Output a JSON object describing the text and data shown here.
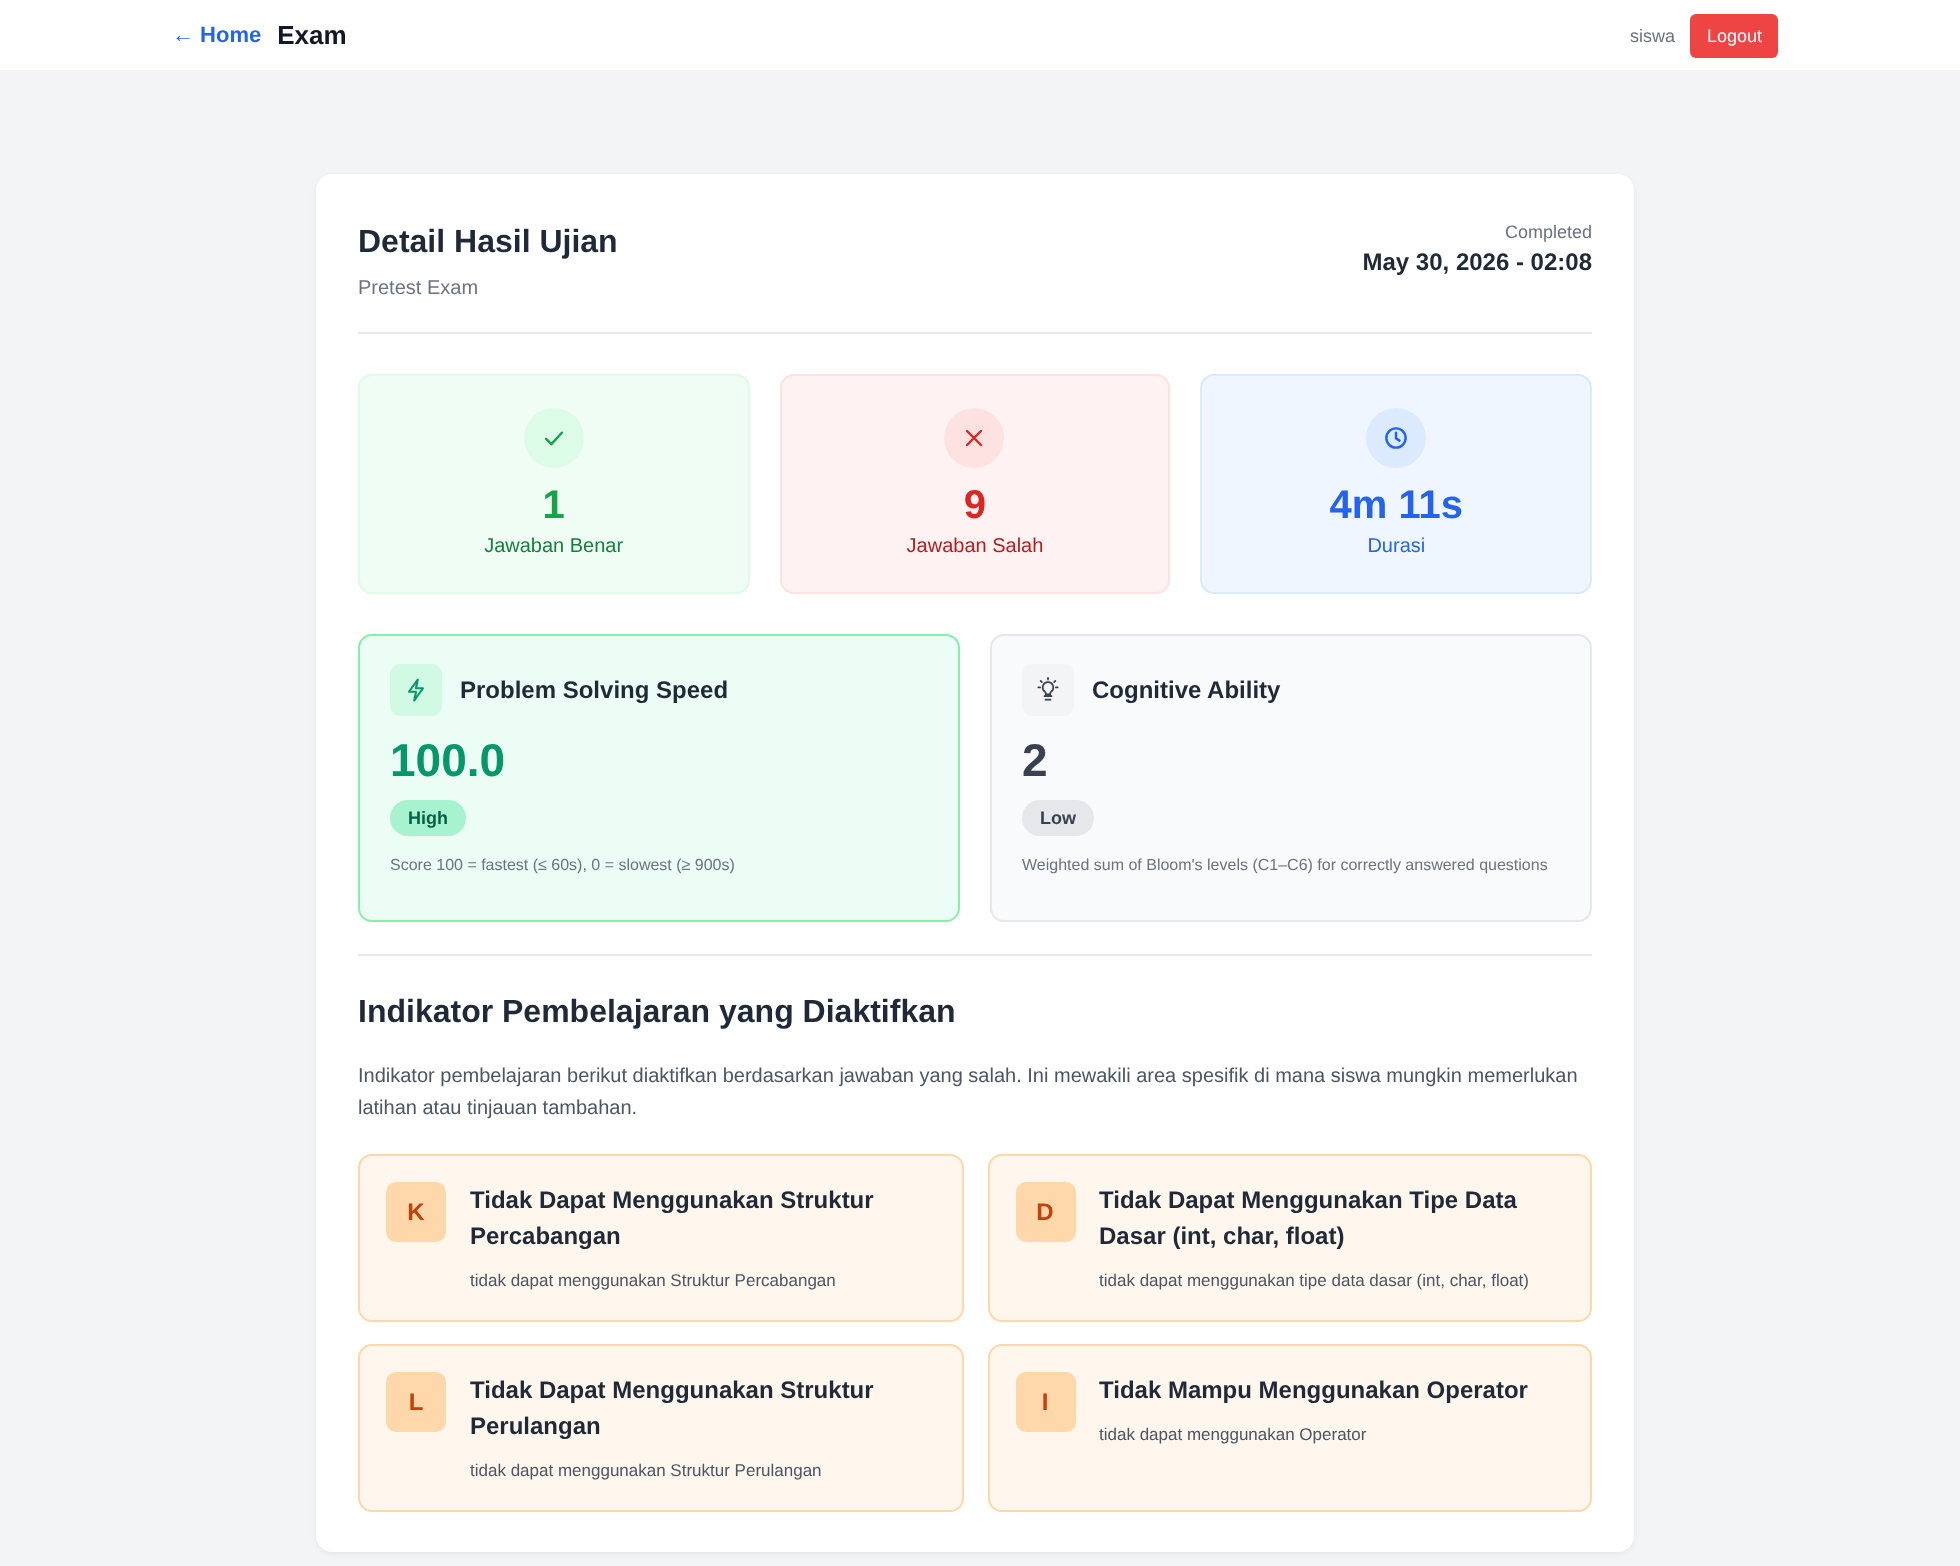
{
  "header": {
    "back_link": "← Home",
    "title": "Exam",
    "user": "siswa",
    "logout": "Logout"
  },
  "result": {
    "title": "Detail Hasil Ujian",
    "subtitle": "Pretest Exam",
    "status": "Completed",
    "date": "May 30, 2026 - 02:08"
  },
  "stats": [
    {
      "kind": "correct",
      "value": "1",
      "label": "Jawaban Benar"
    },
    {
      "kind": "wrong",
      "value": "9",
      "label": "Jawaban Salah"
    },
    {
      "kind": "duration",
      "value": "4m 11s",
      "label": "Durasi"
    }
  ],
  "metrics": [
    {
      "kind": "speed",
      "title": "Problem Solving Speed",
      "value": "100.0",
      "badge": "High",
      "note": "Score 100 = fastest (≤ 60s), 0 = slowest (≥ 900s)"
    },
    {
      "kind": "cognitive",
      "title": "Cognitive Ability",
      "value": "2",
      "badge": "Low",
      "note": "Weighted sum of Bloom's levels (C1–C6) for correctly answered questions"
    }
  ],
  "indicators": {
    "title": "Indikator Pembelajaran yang Diaktifkan",
    "description": "Indikator pembelajaran berikut diaktifkan berdasarkan jawaban yang salah. Ini mewakili area spesifik di mana siswa mungkin memerlukan latihan atau tinjauan tambahan.",
    "items": [
      {
        "letter": "K",
        "title": "Tidak Dapat Menggunakan Struktur Percabangan",
        "description": "tidak dapat menggunakan Struktur Percabangan"
      },
      {
        "letter": "D",
        "title": "Tidak Dapat Menggunakan Tipe Data Dasar (int, char, float)",
        "description": "tidak dapat menggunakan tipe data dasar (int, char, float)"
      },
      {
        "letter": "L",
        "title": "Tidak Dapat Menggunakan Struktur Perulangan",
        "description": "tidak dapat menggunakan Struktur Perulangan"
      },
      {
        "letter": "I",
        "title": "Tidak Mampu Menggunakan Operator",
        "description": "tidak dapat menggunakan Operator"
      }
    ]
  }
}
